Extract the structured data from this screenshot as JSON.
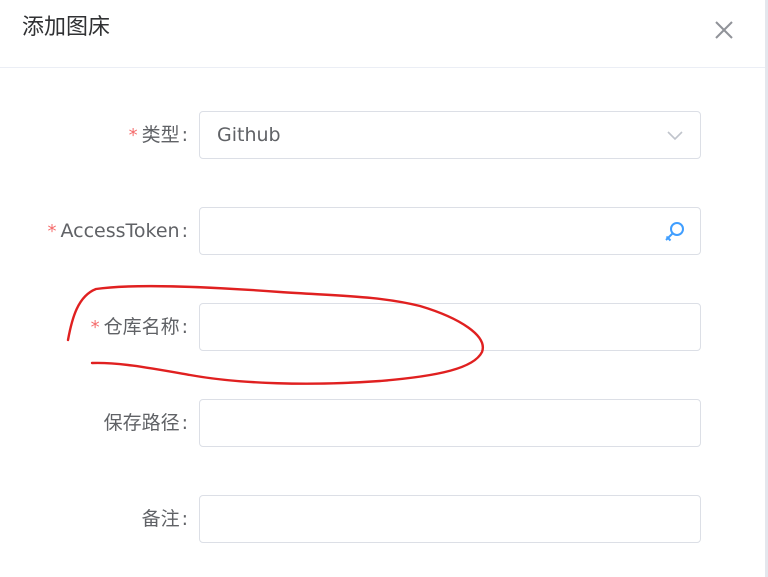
{
  "dialog": {
    "title": "添加图床",
    "close_icon": "close-icon"
  },
  "form": {
    "type": {
      "label": "类型",
      "required": "*",
      "value": "Github",
      "icon": "chevron-down-icon"
    },
    "access_token": {
      "label": "AccessToken",
      "required": "*",
      "value": "",
      "icon": "key-icon"
    },
    "repo_name": {
      "label": "仓库名称",
      "required": "*",
      "value": ""
    },
    "save_path": {
      "label": "保存路径",
      "value": ""
    },
    "note": {
      "label": "备注",
      "value": ""
    },
    "colon": ":"
  },
  "colors": {
    "required": "#f56c6c",
    "annotation": "#e02020",
    "key_icon": "#409eff"
  }
}
